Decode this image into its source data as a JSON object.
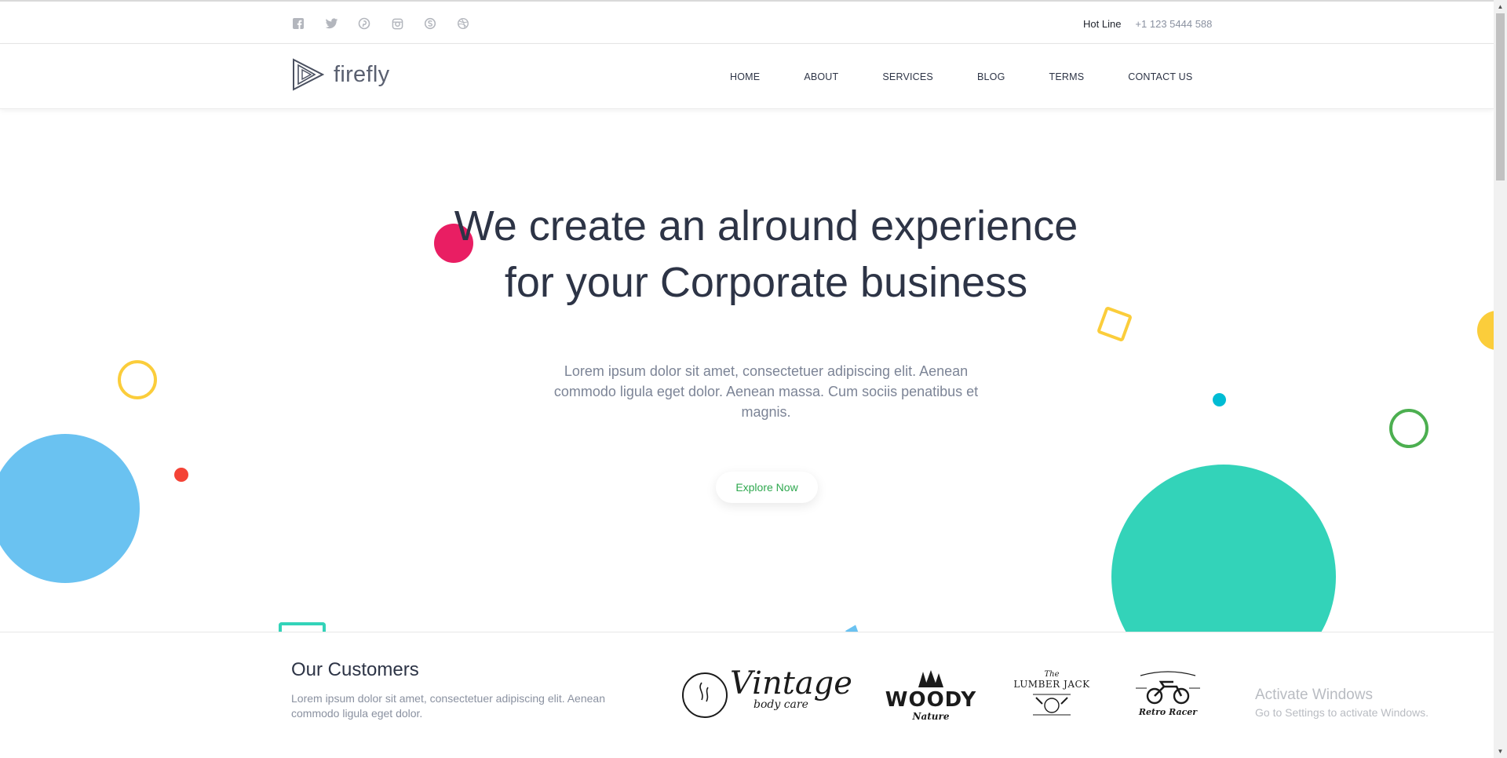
{
  "topbar": {
    "social_icons": [
      "facebook-icon",
      "twitter-icon",
      "pinterest-icon",
      "instagram-icon",
      "skype-icon",
      "dribbble-icon"
    ],
    "hotline_label": "Hot Line",
    "hotline_number": "+1 123 5444 588"
  },
  "header": {
    "logo_text": "firefly",
    "nav": [
      "HOME",
      "ABOUT",
      "SERVICES",
      "BLOG",
      "TERMS",
      "CONTACT US"
    ]
  },
  "hero": {
    "title_line1": "We create an alround experience",
    "title_line2": "for your Corporate business",
    "text": "Lorem ipsum dolor sit amet, consectetuer adipiscing elit. Aenean commodo ligula eget dolor. Aenean massa. Cum sociis penatibus et magnis.",
    "button": "Explore Now"
  },
  "customers": {
    "title": "Our Customers",
    "text": "Lorem ipsum dolor sit amet, consectetuer adipiscing elit. Aenean commodo ligula eget dolor.",
    "brands": {
      "vintage": {
        "title": "Vintage",
        "sub": "body care"
      },
      "woody": {
        "title": "WOODY",
        "sub": "Nature"
      },
      "lumber": {
        "top": "The",
        "title": "LUMBER JACK"
      },
      "retro": {
        "title": "Retro Racer"
      }
    }
  },
  "watermark": {
    "line1": "Activate Windows",
    "line2": "Go to Settings to activate Windows."
  },
  "colors": {
    "accent_green": "#2fa84f",
    "pink": "#e91e63",
    "blue": "#6ac2f1",
    "teal": "#33d3b9",
    "yellow": "#fbcd3b",
    "red": "#f44336",
    "cyan": "#00bcd4",
    "green": "#4caf50"
  }
}
